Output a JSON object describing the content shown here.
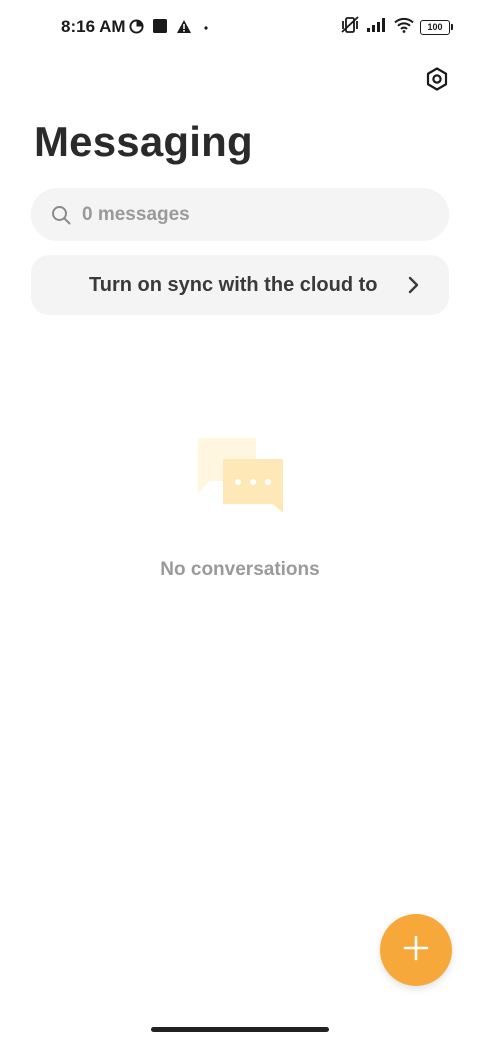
{
  "status_bar": {
    "time": "8:16 AM",
    "battery_level": "100",
    "left_icons": [
      "data-saver-icon",
      "square-icon",
      "warning-icon",
      "dot-icon"
    ],
    "right_icons": [
      "vibrate-off-icon",
      "signal-icon",
      "wifi-icon",
      "battery-icon"
    ]
  },
  "header": {
    "title": "Messaging",
    "settings_icon": "gear-icon"
  },
  "search": {
    "placeholder": "0 messages",
    "icon": "search-icon"
  },
  "sync_banner": {
    "text": "Turn on sync with the cloud to",
    "icon": "chevron-right-icon"
  },
  "empty_state": {
    "message": "No conversations",
    "icon": "chat-bubbles-icon"
  },
  "fab": {
    "icon": "plus-icon"
  },
  "colors": {
    "accent": "#f7a83a",
    "surface": "#f4f4f4",
    "muted_text": "#9a9a9a",
    "illustration_light": "#fff6df",
    "illustration_mid": "#ffe8b8"
  }
}
